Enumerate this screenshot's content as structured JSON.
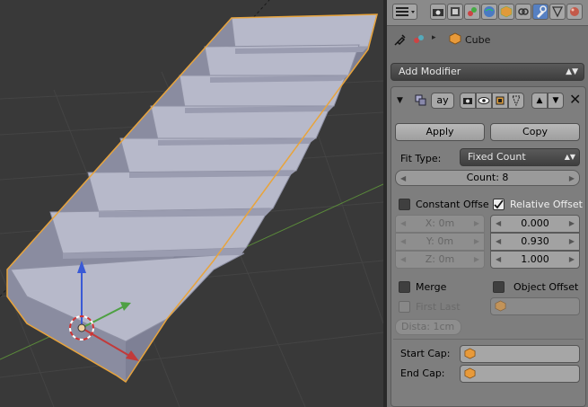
{
  "object": {
    "name": "Cube"
  },
  "properties_header": {
    "icons": [
      "render-icon",
      "render-layers-icon",
      "scene-icon",
      "world-icon",
      "object-icon",
      "constraints-icon",
      "modifiers-icon",
      "data-icon",
      "material-icon"
    ],
    "active_icon": "modifiers-icon"
  },
  "add_modifier": {
    "label": "Add Modifier"
  },
  "modifier": {
    "name": "ay",
    "apply_label": "Apply",
    "copy_label": "Copy",
    "fit_type_label": "Fit Type:",
    "fit_type_value": "Fixed Count",
    "count_label": "Count: 8",
    "constant_offset": {
      "label": "Constant Offse",
      "checked": false,
      "x": "X: 0m",
      "y": "Y: 0m",
      "z": "Z: 0m"
    },
    "relative_offset": {
      "label": "Relative Offset",
      "checked": true,
      "x": "0.000",
      "y": "0.930",
      "z": "1.000"
    },
    "merge": {
      "label": "Merge",
      "checked": false
    },
    "object_offset": {
      "label": "Object Offset",
      "checked": false
    },
    "first_last": {
      "label": "First Last",
      "checked": false
    },
    "distance": "Dista: 1cm",
    "start_cap_label": "Start Cap:",
    "end_cap_label": "End Cap:"
  },
  "colors": {
    "selection_outline": "#e8a43c",
    "active_tab": "#5680c2",
    "axis_red": "#c23a3a",
    "axis_green": "#4ea043"
  }
}
